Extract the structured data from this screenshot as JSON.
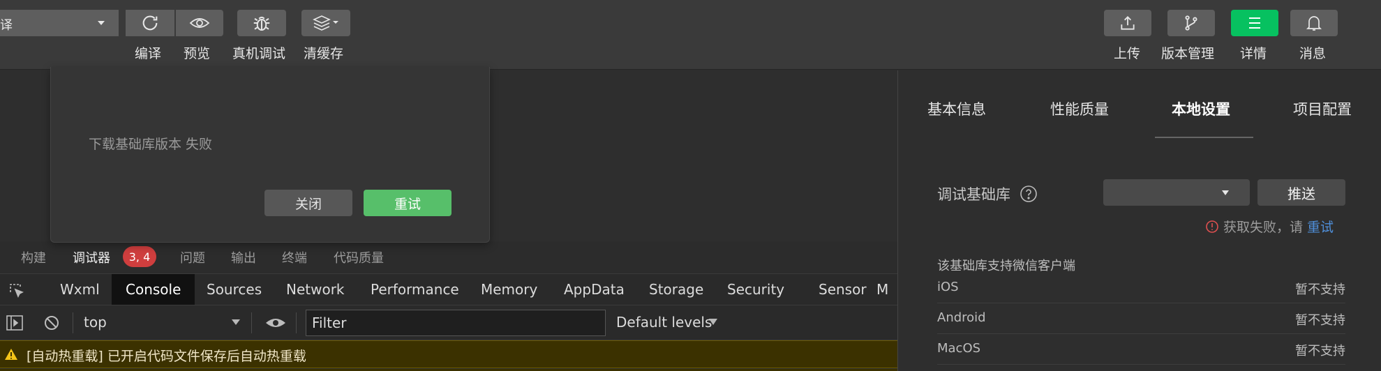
{
  "toolbar": {
    "compile_select_text": "译",
    "buttons": [
      {
        "label": "编译",
        "icon": "refresh-icon"
      },
      {
        "label": "预览",
        "icon": "eye-icon"
      },
      {
        "label": "真机调试",
        "icon": "bug-icon"
      },
      {
        "label": "清缓存",
        "icon": "layers-icon"
      }
    ],
    "right_buttons": [
      {
        "label": "上传",
        "icon": "upload-icon"
      },
      {
        "label": "版本管理",
        "icon": "branch-icon"
      },
      {
        "label": "详情",
        "icon": "menu-icon"
      },
      {
        "label": "消息",
        "icon": "bell-icon"
      }
    ],
    "accent_color": "#07c160"
  },
  "dialog": {
    "message": "下载基础库版本 失败",
    "close_label": "关闭",
    "retry_label": "重试"
  },
  "panel_tabs": {
    "items": [
      "构建",
      "调试器",
      "问题",
      "输出",
      "终端",
      "代码质量"
    ],
    "active": "调试器",
    "debugger_badge": "3, 4"
  },
  "devtools": {
    "tabs": [
      "Wxml",
      "Console",
      "Sources",
      "Network",
      "Performance",
      "Memory",
      "AppData",
      "Storage",
      "Security",
      "Sensor",
      "M"
    ],
    "active": "Console",
    "context": "top",
    "filter_placeholder": "Filter",
    "levels": "Default levels"
  },
  "console": {
    "warning_text": "[自动热重载] 已开启代码文件保存后自动热重载"
  },
  "details": {
    "tabs": [
      "基本信息",
      "性能质量",
      "本地设置",
      "项目配置"
    ],
    "active": "本地设置",
    "debug_lib_label": "调试基础库",
    "push_label": "推送",
    "fail_text": "获取失败，请",
    "retry_link": "重试",
    "support_title": "该基础库支持微信客户端",
    "os_rows": [
      {
        "name": "iOS",
        "status": "暂不支持"
      },
      {
        "name": "Android",
        "status": "暂不支持"
      },
      {
        "name": "MacOS",
        "status": "暂不支持"
      }
    ]
  }
}
